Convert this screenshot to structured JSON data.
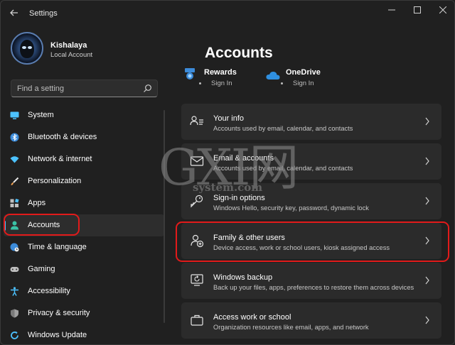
{
  "window": {
    "title": "Settings"
  },
  "profile": {
    "name": "Kishalaya",
    "account_type": "Local Account"
  },
  "search": {
    "placeholder": "Find a setting"
  },
  "nav": {
    "items": [
      {
        "label": "System",
        "icon": "monitor-icon",
        "color": "#4cc2ff"
      },
      {
        "label": "Bluetooth & devices",
        "icon": "bluetooth-icon",
        "color": "#4cc2ff"
      },
      {
        "label": "Network & internet",
        "icon": "wifi-icon",
        "color": "#4cc2ff"
      },
      {
        "label": "Personalization",
        "icon": "brush-icon",
        "color": "#f0a050"
      },
      {
        "label": "Apps",
        "icon": "apps-icon",
        "color": "#c0c0c0"
      },
      {
        "label": "Accounts",
        "icon": "person-icon",
        "color": "#3ac2a5",
        "selected": true
      },
      {
        "label": "Time & language",
        "icon": "globe-clock-icon",
        "color": "#4cc2ff"
      },
      {
        "label": "Gaming",
        "icon": "gamepad-icon",
        "color": "#c0c0c0"
      },
      {
        "label": "Accessibility",
        "icon": "accessibility-icon",
        "color": "#4cc2ff"
      },
      {
        "label": "Privacy & security",
        "icon": "shield-icon",
        "color": "#a0a0a0"
      },
      {
        "label": "Windows Update",
        "icon": "update-icon",
        "color": "#4cc2ff"
      }
    ]
  },
  "main": {
    "title": "Accounts",
    "quick_links": [
      {
        "name": "Rewards",
        "status": "Sign In",
        "icon": "rewards-icon"
      },
      {
        "name": "OneDrive",
        "status": "Sign In",
        "icon": "onedrive-icon"
      }
    ],
    "cards": [
      {
        "title": "Your info",
        "desc": "Accounts used by email, calendar, and contacts",
        "icon": "person-list-icon"
      },
      {
        "title": "Email & accounts",
        "desc": "Accounts used by email, calendar, and contacts",
        "icon": "mail-icon"
      },
      {
        "title": "Sign-in options",
        "desc": "Windows Hello, security key, password, dynamic lock",
        "icon": "key-icon"
      },
      {
        "title": "Family & other users",
        "desc": "Device access, work or school users, kiosk assigned access",
        "icon": "person-add-icon"
      },
      {
        "title": "Windows backup",
        "desc": "Back up your files, apps, preferences to restore them across devices",
        "icon": "backup-icon"
      },
      {
        "title": "Access work or school",
        "desc": "Organization resources like email, apps, and network",
        "icon": "briefcase-icon"
      }
    ]
  },
  "watermark": {
    "big": "GXI网",
    "small": "system.com"
  },
  "colors": {
    "accent": "#4cc2ff",
    "highlight_ring": "#e21a1a",
    "background": "#202020",
    "card": "#2b2b2b"
  }
}
